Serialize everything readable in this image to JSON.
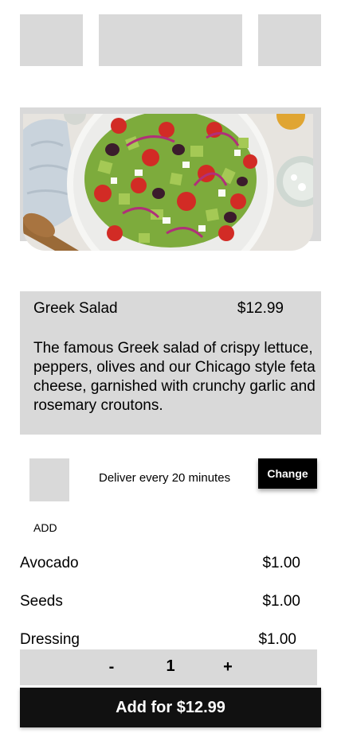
{
  "product": {
    "name": "Greek Salad",
    "price": "$12.99",
    "description": "The famous Greek salad of crispy lettuce, peppers, olives and our Chicago style feta cheese, garnished with crunchy garlic and rosemary croutons."
  },
  "delivery": {
    "text": "Deliver every 20 minutes",
    "change_label": "Change"
  },
  "addons": {
    "heading": "ADD",
    "items": [
      {
        "name": "Avocado",
        "price": "$1.00"
      },
      {
        "name": "Seeds",
        "price": "$1.00"
      },
      {
        "name": "Dressing",
        "price": "$1.00"
      }
    ]
  },
  "quantity": {
    "minus_label": "-",
    "value": "1",
    "plus_label": "+"
  },
  "cart": {
    "add_label": "Add for $12.99"
  },
  "colors": {
    "placeholder": "#d9d9d9",
    "button": "#000000",
    "button_text": "#ffffff"
  }
}
